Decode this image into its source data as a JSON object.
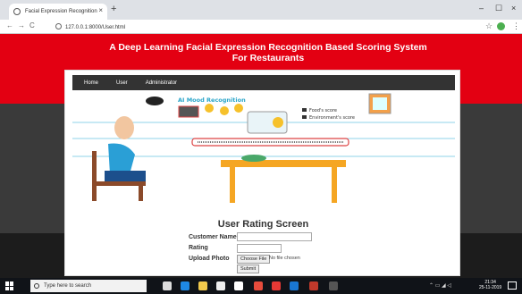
{
  "browser": {
    "tab_title": "Facial Expression Recognition",
    "tab_close": "×",
    "new_tab": "+",
    "minimize": "–",
    "maximize": "☐",
    "close": "×",
    "url": "127.0.0.1:8000/User.html"
  },
  "page": {
    "title": "A Deep Learning Facial Expression Recognition Based Scoring System For Restaurants",
    "nav": [
      "Home",
      "User",
      "Administrator"
    ],
    "illustration": {
      "heading": "AI Mood Recognition",
      "legend_1": "Food's score",
      "legend_2": "Environment's score"
    },
    "form": {
      "title": "User Rating Screen",
      "customer_name_label": "Customer Name",
      "customer_name_value": "",
      "rating_label": "Rating",
      "rating_value": "",
      "upload_label": "Upload Photo",
      "choose_file": "Choose File",
      "no_file": "No file chosen",
      "submit": "Submit"
    }
  },
  "taskbar": {
    "search_placeholder": "Type here to search",
    "time": "21:34",
    "date": "25-11-2019"
  },
  "colors": {
    "header_red": "#e30012",
    "navbar": "#333333",
    "accent_orange": "#f5a623"
  }
}
